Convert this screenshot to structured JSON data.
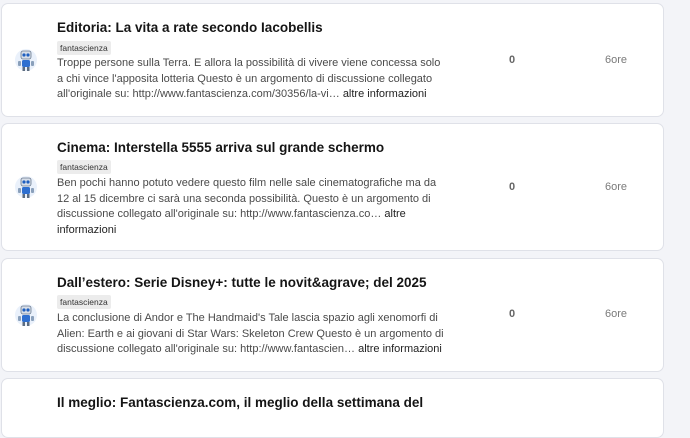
{
  "topics": [
    {
      "title": "Editoria: La vita a rate secondo Iacobellis",
      "tag": "fantascienza",
      "excerpt": "Troppe persone sulla Terra. E allora la possibilità di vivere viene concessa solo a chi vince l'apposita lotteria Questo è un argomento di discussione collegato all'originale su: http://www.fantascienza.com/30356/la-vi…",
      "more": "altre informazioni",
      "replies": "0",
      "activity": "6ore"
    },
    {
      "title": "Cinema: Interstella 5555 arriva sul grande schermo",
      "tag": "fantascienza",
      "excerpt": "Ben pochi hanno potuto vedere questo film nelle sale cinematografiche ma da 12 al 15 dicembre ci sarà una seconda possibilità. Questo è un argomento di discussione collegato all'originale su: http://www.fantascienza.co…",
      "more": "altre informazioni",
      "replies": "0",
      "activity": "6ore"
    },
    {
      "title": "Dall’estero: Serie Disney+: tutte le novit&agrave; del 2025",
      "tag": "fantascienza",
      "excerpt": "La conclusione di Andor e The Handmaid's Tale lascia spazio agli xenomorfi di Alien: Earth e ai giovani di Star Wars: Skeleton Crew Questo è un argomento di discussione collegato all'originale su: http://www.fantascien…",
      "more": "altre informazioni",
      "replies": "0",
      "activity": "6ore"
    },
    {
      "title": "Il meglio: Fantascienza.com, il meglio della settimana del",
      "tag": "",
      "excerpt": "",
      "more": "",
      "replies": "",
      "activity": ""
    }
  ]
}
